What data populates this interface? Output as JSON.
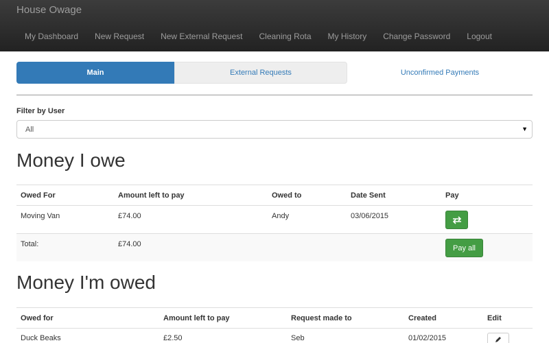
{
  "app": {
    "brand": "House Owage"
  },
  "nav": {
    "items": [
      "My Dashboard",
      "New Request",
      "New External Request",
      "Cleaning Rota",
      "My History",
      "Change Password",
      "Logout"
    ]
  },
  "tabs": {
    "main": "Main",
    "external": "External Requests",
    "unconfirmed": "Unconfirmed Payments"
  },
  "filter": {
    "label": "Filter by User",
    "selected": "All"
  },
  "owe": {
    "title": "Money I owe",
    "headers": [
      "Owed For",
      "Amount left to pay",
      "Owed to",
      "Date Sent",
      "Pay"
    ],
    "rows": [
      {
        "for": "Moving Van",
        "amount": "£74.00",
        "to": "Andy",
        "date": "03/06/2015",
        "pay_icon": "transfer-icon"
      }
    ],
    "total_label": "Total:",
    "total_amount": "£74.00",
    "pay_all": "Pay all"
  },
  "owed": {
    "title": "Money I'm owed",
    "headers": [
      "Owed for",
      "Amount left to pay",
      "Request made to",
      "Created",
      "Edit"
    ],
    "rows": [
      {
        "for": "Duck Beaks",
        "amount": "£2.50",
        "to": "Seb",
        "created": "01/02/2015",
        "edit_icon": "pencil-icon"
      }
    ]
  },
  "colors": {
    "primary": "#337ab7",
    "success": "#449d44",
    "navbar": "#222222"
  }
}
